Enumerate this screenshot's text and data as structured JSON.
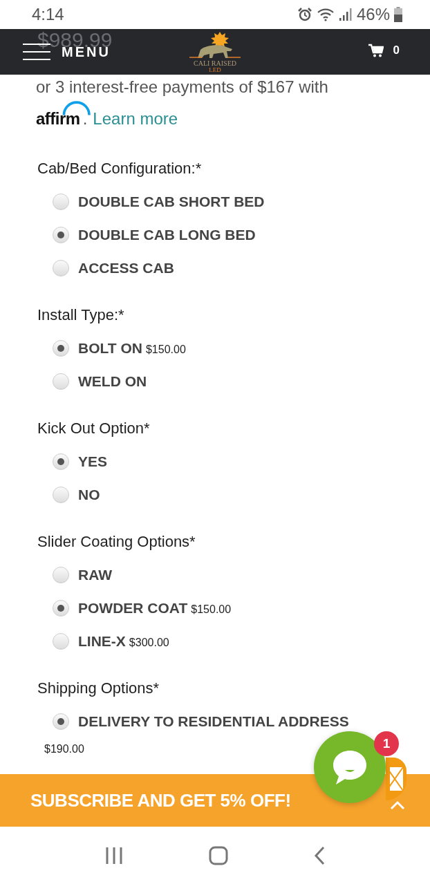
{
  "status_bar": {
    "time": "4:14",
    "battery": "46%"
  },
  "header": {
    "menu_label": "MENU",
    "logo_line1": "CALI RAISED",
    "logo_line2": "LED",
    "cart_count": "0",
    "price_behind": "$989.99"
  },
  "financing": {
    "text": "or 3 interest-free payments of $167 with",
    "brand": "affirm",
    "separator": ".",
    "link": "Learn more"
  },
  "option_groups": [
    {
      "label": "Cab/Bed Configuration:*",
      "options": [
        {
          "label": "DOUBLE CAB SHORT BED",
          "selected": false
        },
        {
          "label": "DOUBLE CAB LONG BED",
          "selected": true
        },
        {
          "label": "ACCESS CAB",
          "selected": false
        }
      ]
    },
    {
      "label": "Install Type:*",
      "options": [
        {
          "label": "BOLT ON",
          "price": "$150.00",
          "selected": true
        },
        {
          "label": "WELD ON",
          "selected": false
        }
      ]
    },
    {
      "label": "Kick Out Option*",
      "options": [
        {
          "label": "YES",
          "selected": true
        },
        {
          "label": "NO",
          "selected": false
        }
      ]
    },
    {
      "label": "Slider Coating Options*",
      "options": [
        {
          "label": "RAW",
          "selected": false
        },
        {
          "label": "POWDER COAT",
          "price": "$150.00",
          "selected": true
        },
        {
          "label": "LINE-X",
          "price": "$300.00",
          "selected": false
        }
      ]
    },
    {
      "label": "Shipping Options*",
      "options": [
        {
          "label": "DELIVERY TO RESIDENTIAL ADDRESS",
          "price": "$190.00",
          "price_wrapped": true,
          "selected": true
        }
      ]
    }
  ],
  "subscribe_bar": {
    "text": "SUBSCRIBE AND GET 5% OFF!"
  },
  "chat": {
    "badge": "1"
  }
}
